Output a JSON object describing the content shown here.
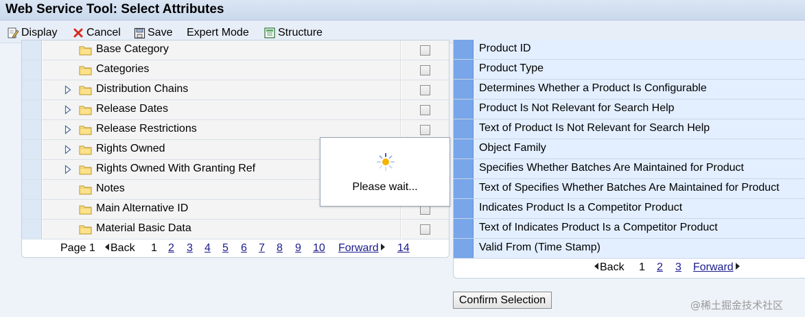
{
  "window": {
    "title": "Web Service Tool: Select Attributes"
  },
  "toolbar": {
    "display": "Display",
    "cancel": "Cancel",
    "save": "Save",
    "expert_mode": "Expert Mode",
    "structure": "Structure"
  },
  "tree": {
    "rows": [
      {
        "label": "Base Category",
        "expandable": false
      },
      {
        "label": "Categories",
        "expandable": false
      },
      {
        "label": "Distribution Chains",
        "expandable": true
      },
      {
        "label": "Release Dates",
        "expandable": true
      },
      {
        "label": "Release Restrictions",
        "expandable": true
      },
      {
        "label": "Rights Owned",
        "expandable": true
      },
      {
        "label": "Rights Owned With Granting Ref",
        "expandable": true
      },
      {
        "label": "Notes",
        "expandable": false
      },
      {
        "label": "Main Alternative ID",
        "expandable": false
      },
      {
        "label": "Material Basic Data",
        "expandable": false
      }
    ],
    "pager": {
      "page_label": "Page 1",
      "back": "Back",
      "current": "1",
      "pages": [
        "2",
        "3",
        "4",
        "5",
        "6",
        "7",
        "8",
        "9",
        "10"
      ],
      "forward": "Forward",
      "last": "14"
    }
  },
  "selected": {
    "rows": [
      "Product ID",
      "Product Type",
      "Determines Whether a Product Is Configurable",
      "Product Is Not Relevant for Search Help",
      "Text of Product Is Not Relevant for Search Help",
      "Object Family",
      "Specifies Whether Batches Are Maintained for Product",
      "Text of Specifies Whether Batches Are Maintained for Product",
      "Indicates Product Is a Competitor Product",
      "Text of Indicates Product Is a Competitor Product",
      "Valid From (Time Stamp)"
    ],
    "pager": {
      "back": "Back",
      "current": "1",
      "pages": [
        "2",
        "3"
      ],
      "forward": "Forward"
    }
  },
  "confirm_label": "Confirm Selection",
  "wait_dialog": {
    "message": "Please wait..."
  },
  "watermark": "@稀土掘金技术社区",
  "colors": {
    "selected_marker": "#78a6e8",
    "selected_row_bg": "#e3efff",
    "link": "#1a1a8c"
  }
}
